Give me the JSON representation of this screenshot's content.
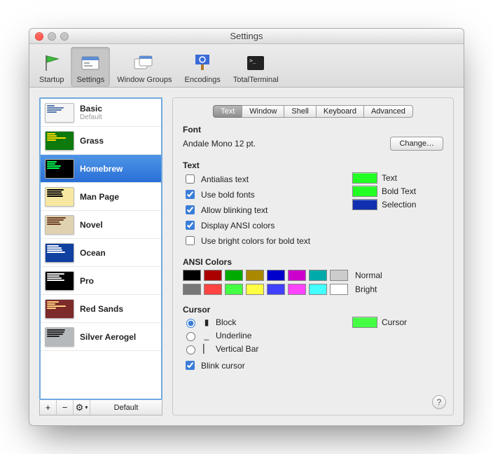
{
  "window": {
    "title": "Settings"
  },
  "toolbar": {
    "items": [
      {
        "label": "Startup"
      },
      {
        "label": "Settings"
      },
      {
        "label": "Window Groups"
      },
      {
        "label": "Encodings"
      },
      {
        "label": "TotalTerminal"
      }
    ],
    "selected_index": 1
  },
  "profiles": {
    "items": [
      {
        "name": "Basic",
        "sub": "Default",
        "bg": "#f5f5f5",
        "fg": "#5577aa"
      },
      {
        "name": "Grass",
        "sub": "",
        "bg": "#0e7a0e",
        "fg": "#ffdc00"
      },
      {
        "name": "Homebrew",
        "sub": "",
        "bg": "#000000",
        "fg": "#00ff55"
      },
      {
        "name": "Man Page",
        "sub": "",
        "bg": "#f6e8a0",
        "fg": "#000000"
      },
      {
        "name": "Novel",
        "sub": "",
        "bg": "#e0d2b0",
        "fg": "#6b3e1f"
      },
      {
        "name": "Ocean",
        "sub": "",
        "bg": "#1040a0",
        "fg": "#ffffff"
      },
      {
        "name": "Pro",
        "sub": "",
        "bg": "#000000",
        "fg": "#f2f2f2"
      },
      {
        "name": "Red Sands",
        "sub": "",
        "bg": "#7d2a2a",
        "fg": "#ffd27f"
      },
      {
        "name": "Silver Aerogel",
        "sub": "",
        "bg": "#b5b9bc",
        "fg": "#222222"
      }
    ],
    "selected_index": 2,
    "add_label": "+",
    "remove_label": "−",
    "gear_label": "⚙",
    "default_button": "Default"
  },
  "tabs": {
    "items": [
      "Text",
      "Window",
      "Shell",
      "Keyboard",
      "Advanced"
    ],
    "selected_index": 0
  },
  "font": {
    "section": "Font",
    "desc": "Andale Mono 12 pt.",
    "change_button": "Change…"
  },
  "text": {
    "section": "Text",
    "antialias": {
      "label": "Antialias text",
      "checked": false
    },
    "bold": {
      "label": "Use bold fonts",
      "checked": true
    },
    "blink": {
      "label": "Allow blinking text",
      "checked": true
    },
    "ansi": {
      "label": "Display ANSI colors",
      "checked": true
    },
    "bright": {
      "label": "Use bright colors for bold text",
      "checked": false
    },
    "swatches": {
      "text": {
        "label": "Text",
        "color": "#22ff22"
      },
      "bold_text": {
        "label": "Bold Text",
        "color": "#22ff22"
      },
      "selection": {
        "label": "Selection",
        "color": "#1030b0"
      }
    }
  },
  "ansi_colors": {
    "section": "ANSI Colors",
    "normal_label": "Normal",
    "bright_label": "Bright",
    "normal": [
      "#000000",
      "#aa0000",
      "#00aa00",
      "#aa8800",
      "#0000cc",
      "#cc00cc",
      "#00aaaa",
      "#cccccc"
    ],
    "bright": [
      "#777777",
      "#ff4444",
      "#44ff44",
      "#ffff44",
      "#4040ff",
      "#ff44ff",
      "#44ffff",
      "#ffffff"
    ]
  },
  "cursor": {
    "section": "Cursor",
    "shape": "block",
    "block_label": "Block",
    "underline_label": "Underline",
    "vertical_label": "Vertical Bar",
    "blink": {
      "label": "Blink cursor",
      "checked": true
    },
    "swatch": {
      "label": "Cursor",
      "color": "#44ff44"
    }
  }
}
